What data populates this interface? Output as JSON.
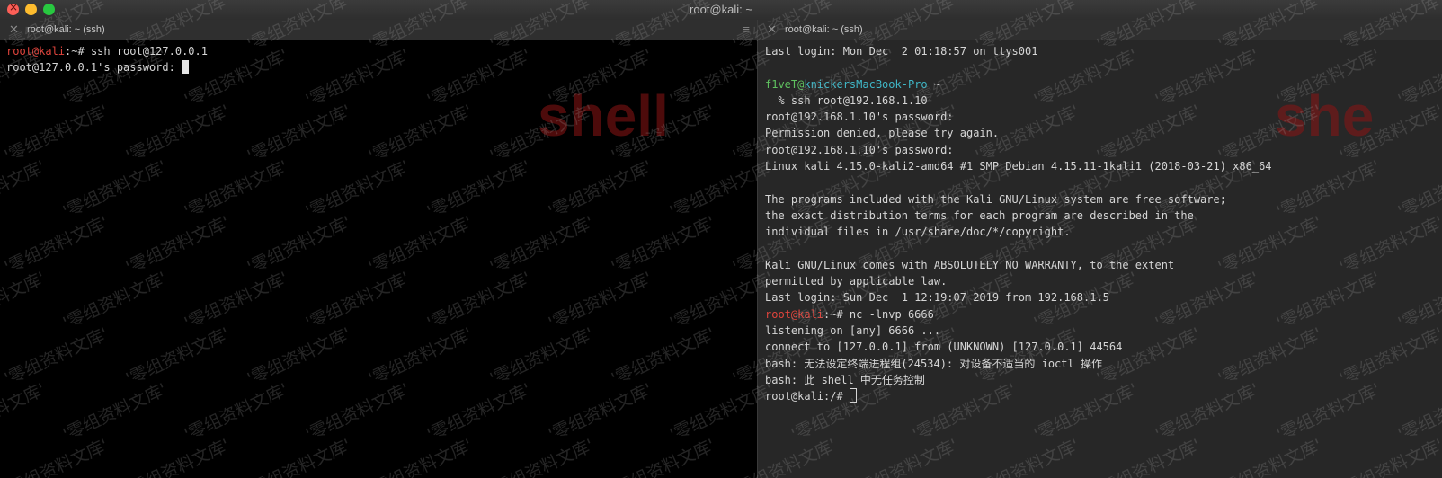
{
  "window": {
    "title": "root@kali: ~"
  },
  "left_pane": {
    "tab_label": "root@kali: ~ (ssh)",
    "prompt_user": "root@kali",
    "prompt_path": ":~# ",
    "command": "ssh root@127.0.0.1",
    "line2": "root@127.0.0.1's password: "
  },
  "right_pane": {
    "tab_label": "root@kali: ~ (ssh)",
    "lines": {
      "l1": "Last login: Mon Dec  2 01:18:57 on ttys001",
      "l3_user": "f1veT",
      "l3_at": "@",
      "l3_host": "knickersMacBook-Pro",
      "l3_path": " ~",
      "l4": "  % ssh root@192.168.1.10",
      "l5": "root@192.168.1.10's password:",
      "l6": "Permission denied, please try again.",
      "l7": "root@192.168.1.10's password:",
      "l8": "Linux kali 4.15.0-kali2-amd64 #1 SMP Debian 4.15.11-1kali1 (2018-03-21) x86_64",
      "l10": "The programs included with the Kali GNU/Linux system are free software;",
      "l11": "the exact distribution terms for each program are described in the",
      "l12": "individual files in /usr/share/doc/*/copyright.",
      "l14": "Kali GNU/Linux comes with ABSOLUTELY NO WARRANTY, to the extent",
      "l15": "permitted by applicable law.",
      "l16": "Last login: Sun Dec  1 12:19:07 2019 from 192.168.1.5",
      "l17_user": "root@kali",
      "l17_rest": ":~# nc -lnvp 6666",
      "l18": "listening on [any] 6666 ...",
      "l19": "connect to [127.0.0.1] from (UNKNOWN) [127.0.0.1] 44564",
      "l20": "bash: 无法设定终端进程组(24534): 对设备不适当的 ioctl 操作",
      "l21": "bash: 此 shell 中无任务控制",
      "l22": "root@kali:/# "
    }
  },
  "watermarks": {
    "shell_left": "shell",
    "shell_right": "she",
    "repeat_text": "零组资料文库"
  }
}
